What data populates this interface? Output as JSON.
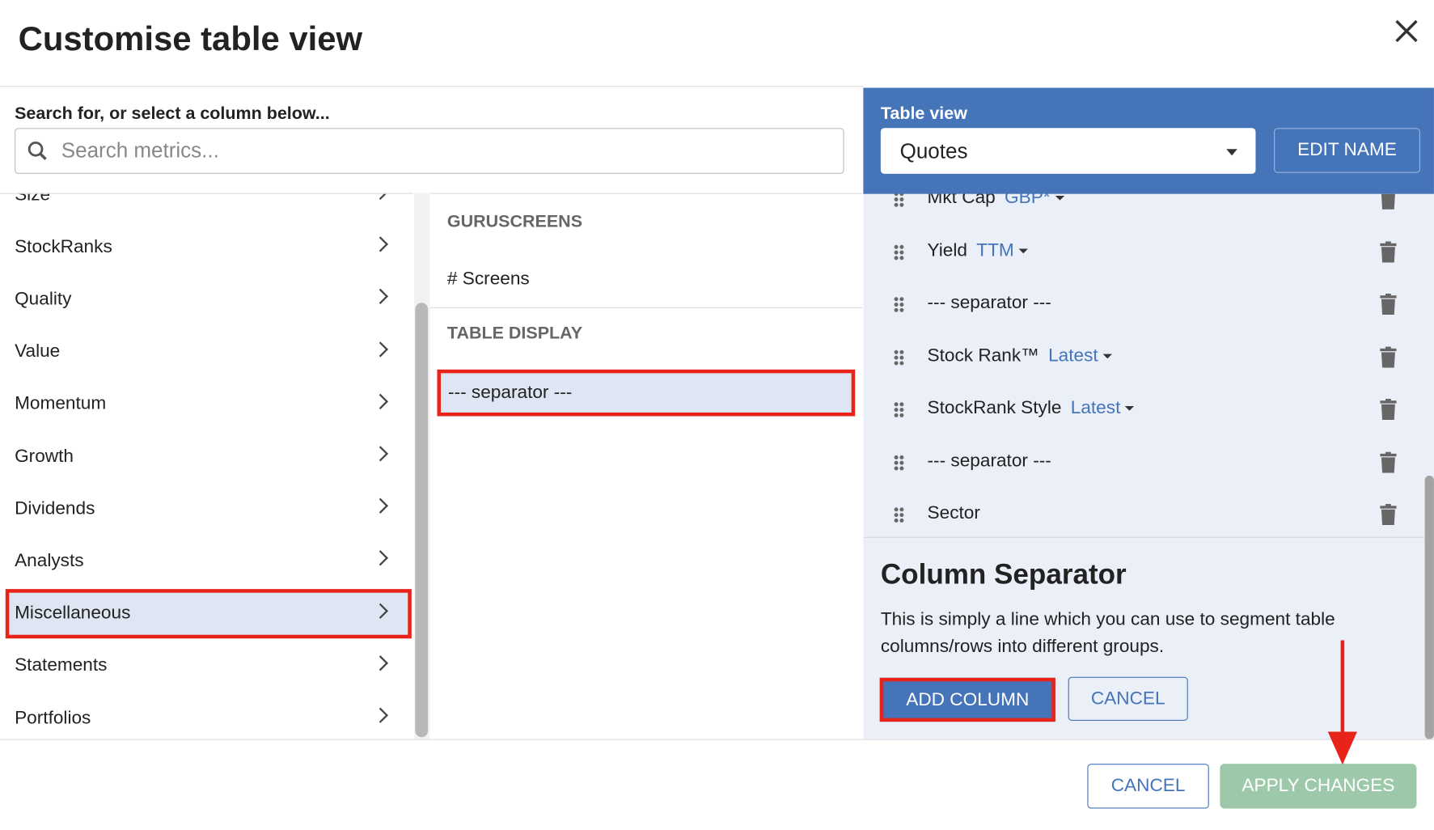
{
  "dialog": {
    "title": "Customise table view",
    "close_icon": "close-icon"
  },
  "search": {
    "label": "Search for, or select a column below...",
    "placeholder": "Search metrics...",
    "value": ""
  },
  "categories": [
    {
      "label": "Size"
    },
    {
      "label": "StockRanks"
    },
    {
      "label": "Quality"
    },
    {
      "label": "Value"
    },
    {
      "label": "Momentum"
    },
    {
      "label": "Growth"
    },
    {
      "label": "Dividends"
    },
    {
      "label": "Analysts"
    },
    {
      "label": "Miscellaneous",
      "selected": true
    },
    {
      "label": "Statements"
    },
    {
      "label": "Portfolios"
    }
  ],
  "middle": {
    "sections": [
      {
        "header": "GURUSCREENS",
        "items": [
          "# Screens"
        ]
      },
      {
        "header": "TABLE DISPLAY",
        "items": [
          "--- separator ---"
        ]
      }
    ]
  },
  "table_view": {
    "label": "Table view",
    "selected": "Quotes",
    "edit_name": "EDIT NAME"
  },
  "columns": [
    {
      "name": "Mkt Cap",
      "option": "GBP*"
    },
    {
      "name": "Yield",
      "option": "TTM"
    },
    {
      "name": "--- separator ---",
      "option": ""
    },
    {
      "name": "Stock Rank™",
      "option": "Latest"
    },
    {
      "name": "StockRank Style",
      "option": "Latest"
    },
    {
      "name": "--- separator ---",
      "option": ""
    },
    {
      "name": "Sector",
      "option": ""
    }
  ],
  "detail": {
    "title": "Column Separator",
    "description": "This is simply a line which you can use to segment table columns/rows into different groups.",
    "add_column": "ADD COLUMN",
    "cancel": "CANCEL"
  },
  "footer": {
    "cancel": "CANCEL",
    "apply": "APPLY CHANGES"
  },
  "colors": {
    "accent": "#4674b9",
    "highlight": "#e8231a",
    "apply": "#9dc9aa",
    "panel": "#eaeff8"
  }
}
